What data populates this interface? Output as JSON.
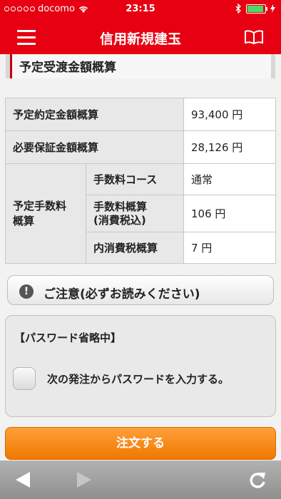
{
  "status_bar": {
    "carrier": "docomo",
    "time": "23:15"
  },
  "nav": {
    "title": "信用新規建玉",
    "menu_icon": "hamburger-icon",
    "right_icon": "book-icon"
  },
  "section": {
    "title": "予定受渡金額概算"
  },
  "estimate_table": {
    "contract_amount": {
      "label": "予定約定金額概算",
      "value": "93,400 円"
    },
    "margin_required": {
      "label": "必要保証金額概算",
      "value": "28,126 円"
    },
    "fee_group_label": "予定手数料\n概算",
    "fee_course": {
      "label": "手数料コース",
      "value": "通常"
    },
    "fee_estimate": {
      "label": "手数料概算\n(消費税込)",
      "value": "106 円"
    },
    "consumption_tax": {
      "label": "内消費税概算",
      "value": "7 円"
    }
  },
  "caution": {
    "label": "ご注意(必ずお読みください)",
    "icon": "warning-icon"
  },
  "password_panel": {
    "title": "【パスワード省略中】",
    "checkbox_label": "次の発注からパスワードを入力する。",
    "checked": false
  },
  "order_button": {
    "label": "注文する"
  },
  "toolbar": {
    "back_icon": "back-arrow-icon",
    "forward_icon": "forward-arrow-icon",
    "reload_icon": "reload-icon"
  },
  "colors": {
    "brand_red": "#e60012",
    "order_orange": "#f07800"
  }
}
